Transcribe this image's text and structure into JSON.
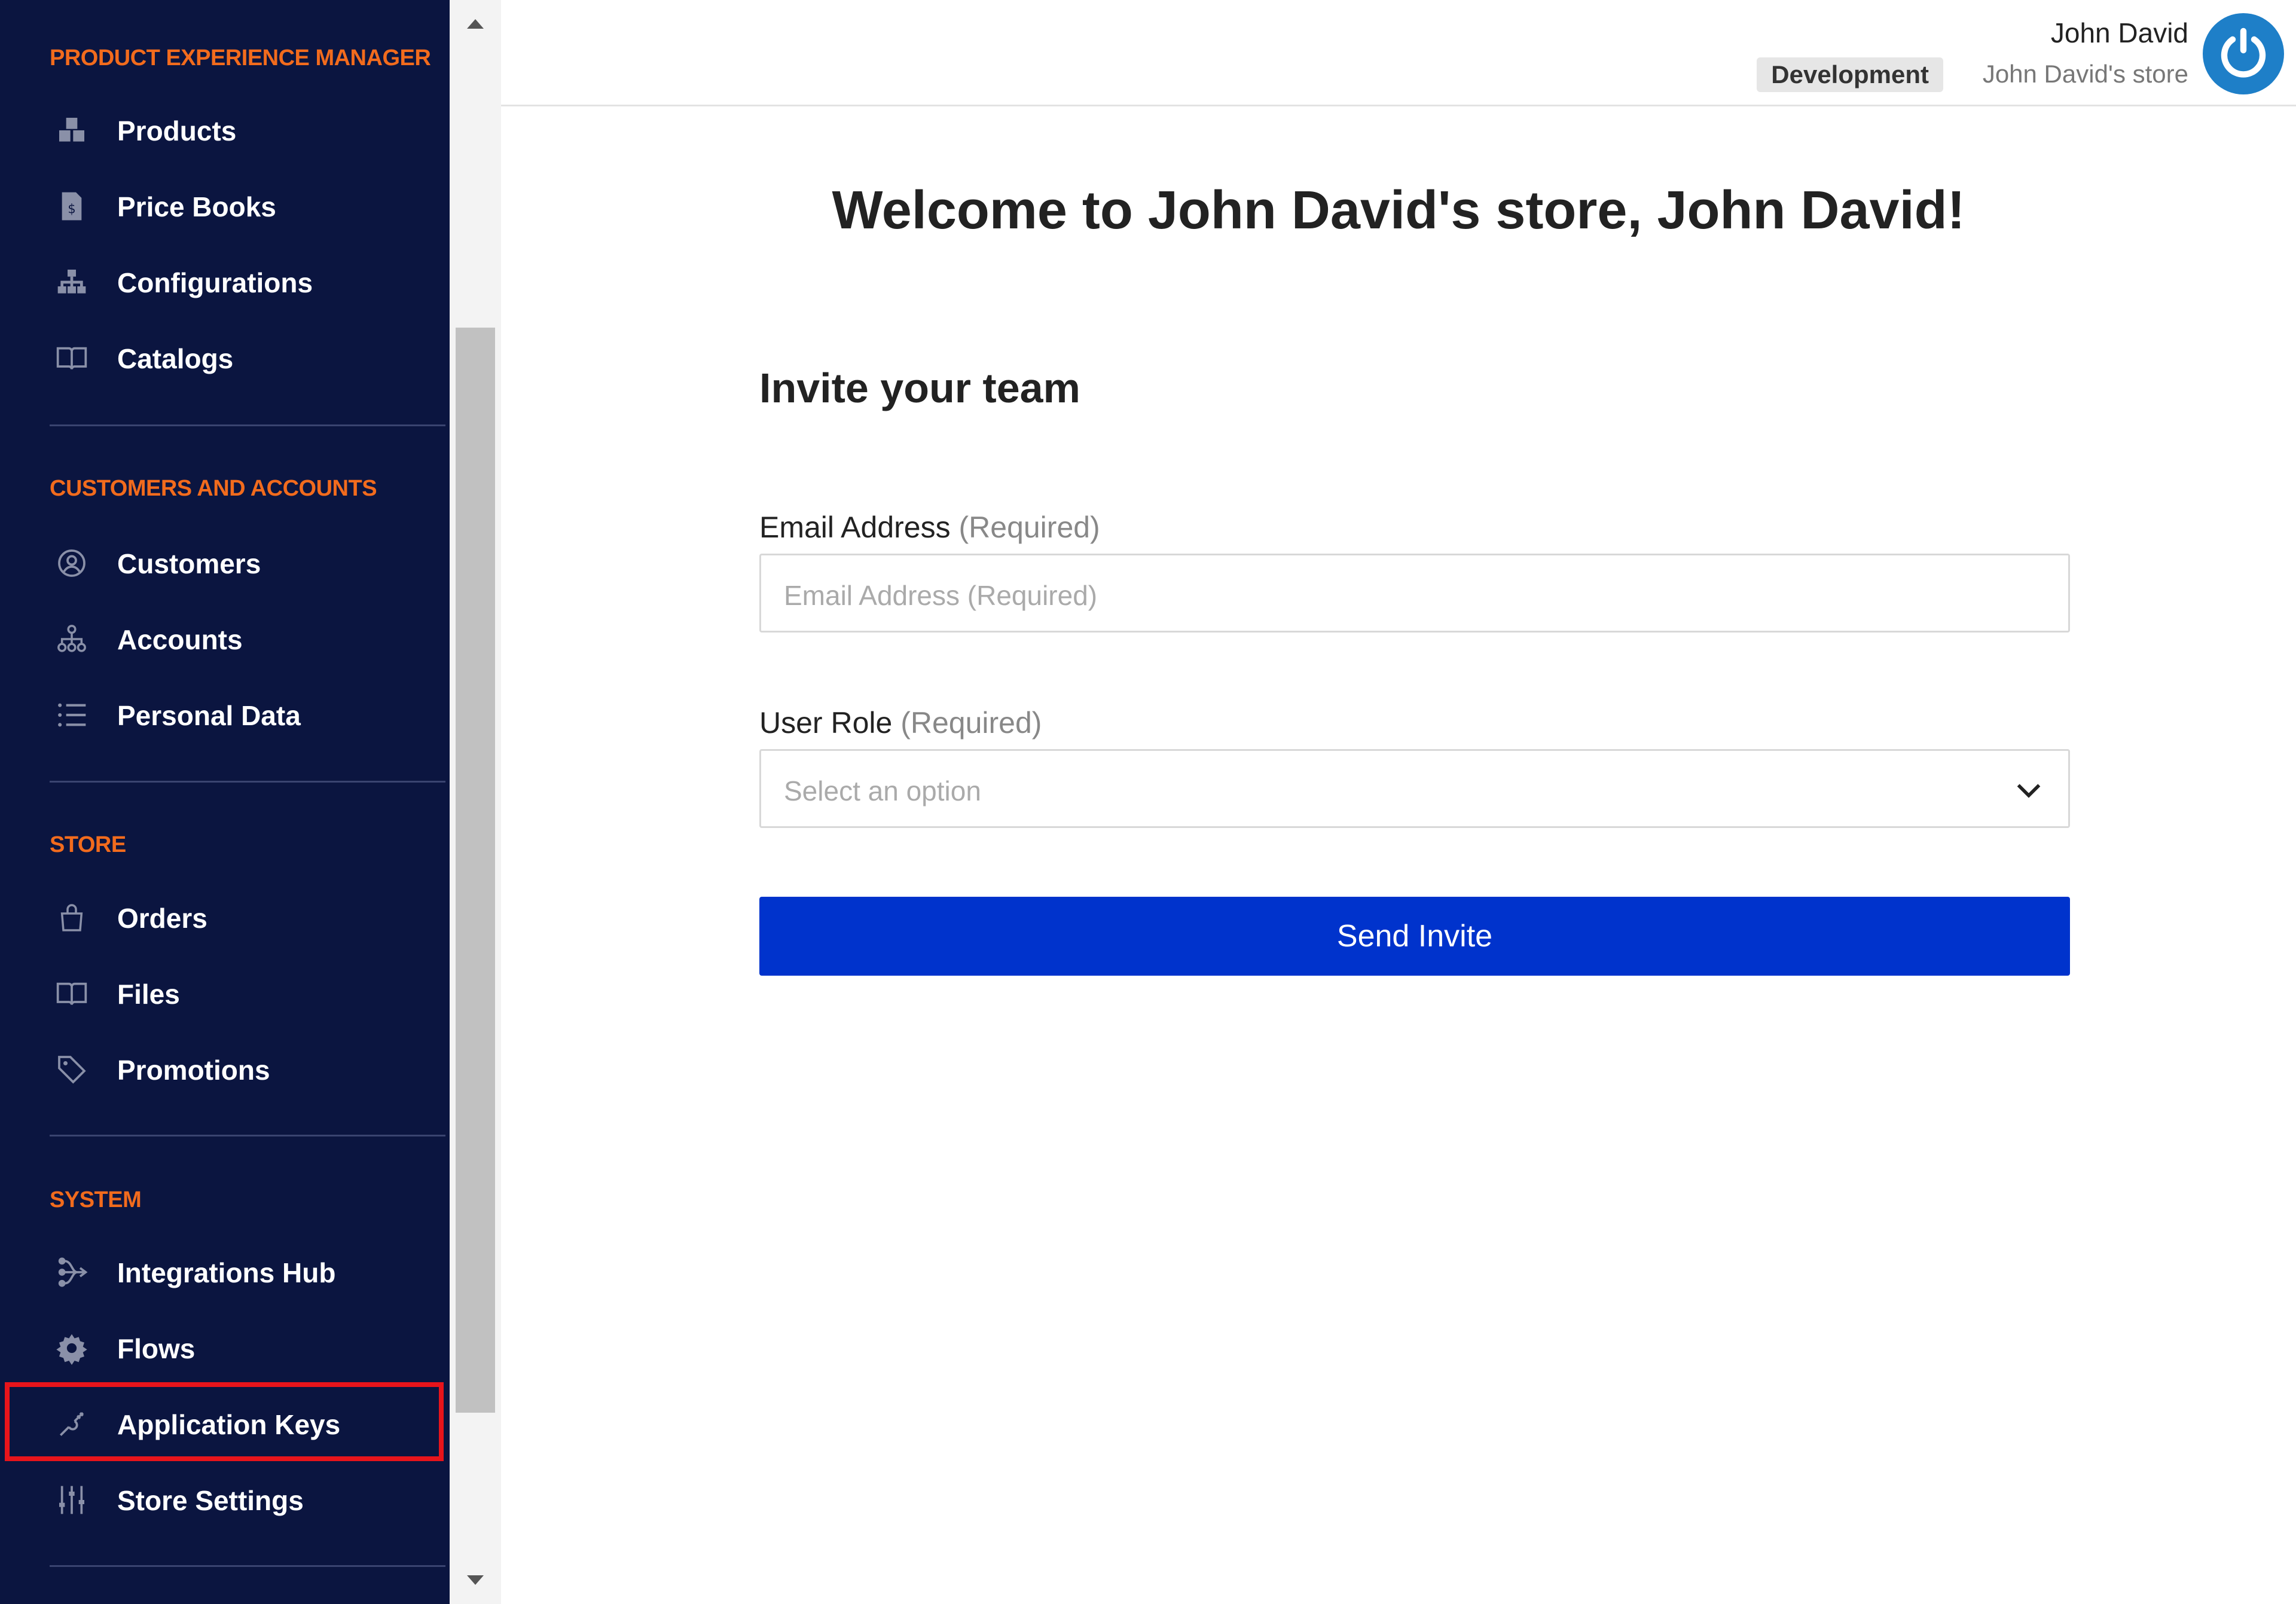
{
  "sidebar": {
    "sections": [
      {
        "title": "PRODUCT EXPERIENCE MANAGER",
        "items": [
          {
            "label": "Products",
            "icon": "products-icon"
          },
          {
            "label": "Price Books",
            "icon": "price-book-icon"
          },
          {
            "label": "Configurations",
            "icon": "hierarchy-icon"
          },
          {
            "label": "Catalogs",
            "icon": "book-icon"
          }
        ]
      },
      {
        "title": "CUSTOMERS AND ACCOUNTS",
        "items": [
          {
            "label": "Customers",
            "icon": "user-circle-icon"
          },
          {
            "label": "Accounts",
            "icon": "accounts-tree-icon"
          },
          {
            "label": "Personal Data",
            "icon": "list-icon"
          }
        ]
      },
      {
        "title": "STORE",
        "items": [
          {
            "label": "Orders",
            "icon": "bag-icon"
          },
          {
            "label": "Files",
            "icon": "book-icon"
          },
          {
            "label": "Promotions",
            "icon": "tag-icon"
          }
        ]
      },
      {
        "title": "SYSTEM",
        "items": [
          {
            "label": "Integrations Hub",
            "icon": "integrations-icon"
          },
          {
            "label": "Flows",
            "icon": "gear-icon"
          },
          {
            "label": "Application Keys",
            "icon": "key-link-icon",
            "highlighted": true
          },
          {
            "label": "Store Settings",
            "icon": "sliders-icon"
          }
        ]
      }
    ],
    "highlight_color": "#e8141b"
  },
  "header": {
    "user_name": "John David",
    "environment": "Development",
    "store_name": "John David's store"
  },
  "main": {
    "welcome": "Welcome to John David's store, John David!",
    "invite_title": "Invite your team",
    "email": {
      "label": "Email Address",
      "required": "(Required)",
      "placeholder": "Email Address (Required)",
      "value": ""
    },
    "role": {
      "label": "User Role",
      "required": "(Required)",
      "placeholder": "Select an option"
    },
    "send_button": "Send Invite"
  },
  "colors": {
    "sidebar_bg": "#0b1540",
    "section_title": "#f26b1d",
    "primary_button": "#0033cc",
    "power_button": "#1e7fc8"
  }
}
